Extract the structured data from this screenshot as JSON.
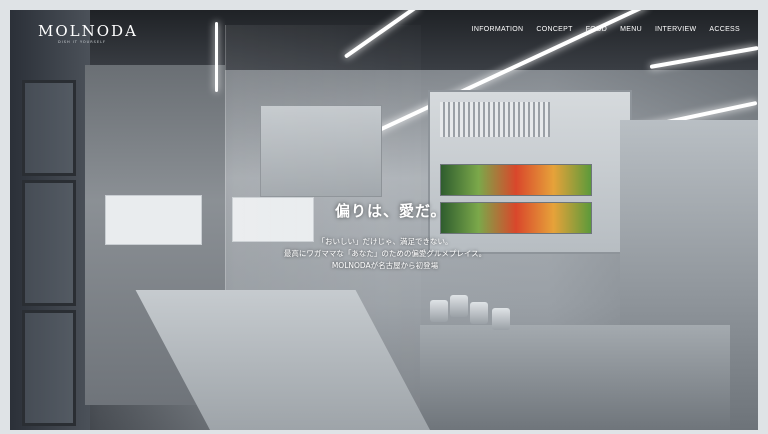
{
  "brand": {
    "logo": "MOLNODA",
    "tagline": "DISH IT YOURSELF"
  },
  "nav": {
    "items": [
      "INFORMATION",
      "CONCEPT",
      "FOOD",
      "MENU",
      "INTERVIEW",
      "ACCESS"
    ]
  },
  "hero": {
    "headline": "偏りは、愛だ。",
    "lines": [
      "「おいしい」だけじゃ、満足できない。",
      "最高にワガママな「あなた」のための偏愛グルメプレイス。",
      "MOLNODAが名古屋から初登場"
    ]
  }
}
